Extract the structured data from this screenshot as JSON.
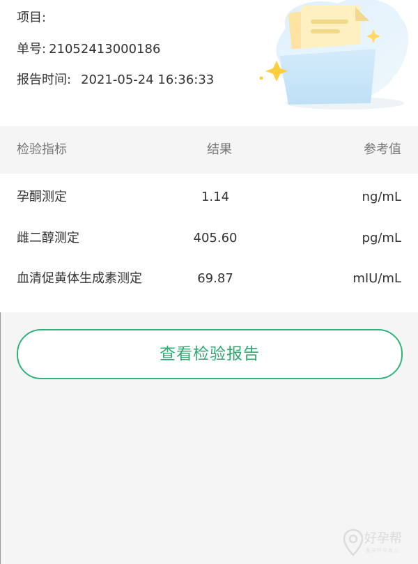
{
  "report": {
    "project_label": "项目:",
    "project_value": "",
    "order_label": "单号:",
    "order_value": "21052413000186",
    "time_label": "报告时间:",
    "time_value": "2021-05-24 16:36:33"
  },
  "table": {
    "headers": [
      "检验指标",
      "结果",
      "参考值"
    ],
    "rows": [
      {
        "indicator": "孕酮测定",
        "result": "1.14",
        "unit": "ng/mL"
      },
      {
        "indicator": "雌二醇测定",
        "result": "405.60",
        "unit": "pg/mL"
      },
      {
        "indicator": "血清促黄体生成素测定",
        "result": "69.87",
        "unit": "mIU/mL"
      }
    ]
  },
  "actions": {
    "view_report_label": "查看检验报告"
  },
  "watermark": {
    "text": "好孕帮",
    "sub": "备孕怀孕育儿"
  },
  "colors": {
    "accent": "#2fb37a",
    "background": "#f5f5f5",
    "card": "#ffffff",
    "text": "#333333",
    "muted": "#777777"
  },
  "icons": {
    "illustration": "report-folder-illustration",
    "watermark": "location-pin-icon"
  }
}
